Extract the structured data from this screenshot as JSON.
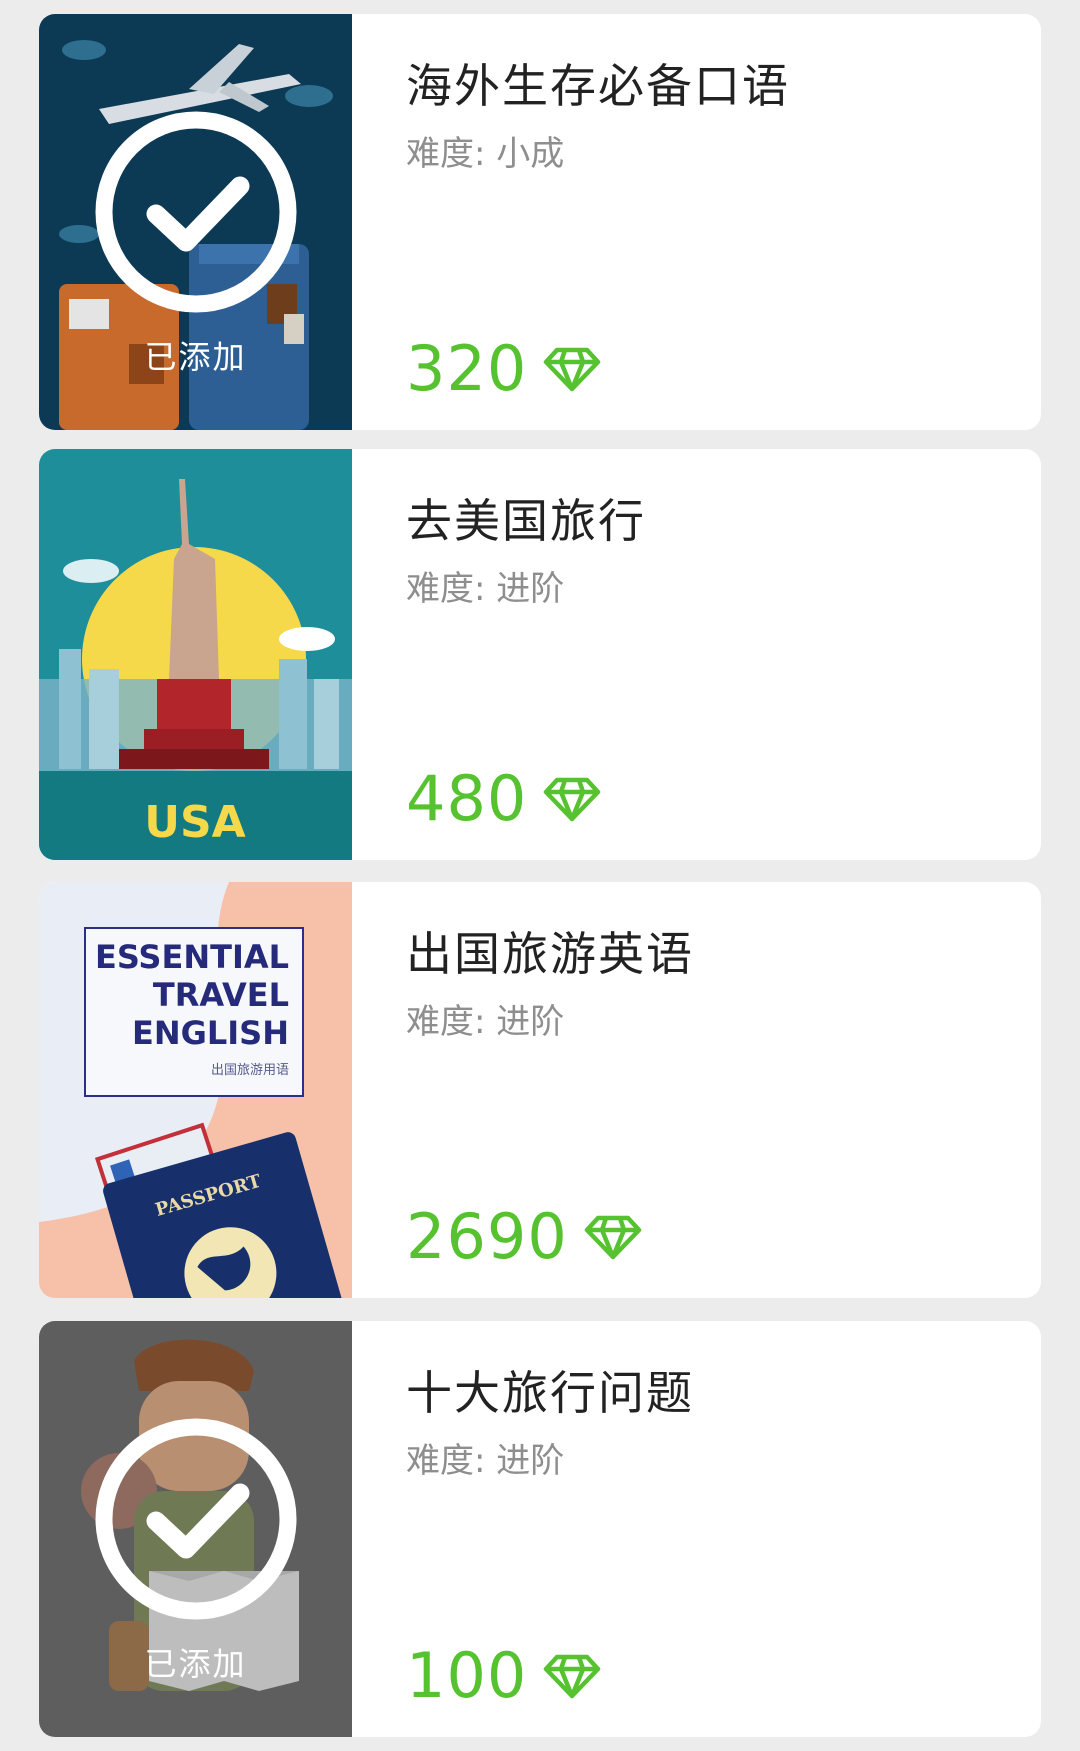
{
  "level_prefix": "难度:",
  "added_label": "已添加",
  "colors": {
    "accent_green": "#56c22f",
    "title": "#222222",
    "subtitle": "#8e8e8e"
  },
  "courses": [
    {
      "title": "海外生存必备口语",
      "level": "小成",
      "price": "320",
      "added": true,
      "thumb": "travel-luggage-plane"
    },
    {
      "title": "去美国旅行",
      "level": "进阶",
      "price": "480",
      "added": false,
      "thumb": "statue-of-liberty",
      "thumb_text": "USA"
    },
    {
      "title": "出国旅游英语",
      "level": "进阶",
      "price": "2690",
      "added": false,
      "thumb": "passport-boarding-pass",
      "thumb_text": [
        "ESSENTIAL",
        "TRAVEL",
        "ENGLISH",
        "出国旅游用语",
        "PASSPORT"
      ]
    },
    {
      "title": "十大旅行问题",
      "level": "进阶",
      "price": "100",
      "added": true,
      "thumb": "traveler-with-map"
    }
  ]
}
